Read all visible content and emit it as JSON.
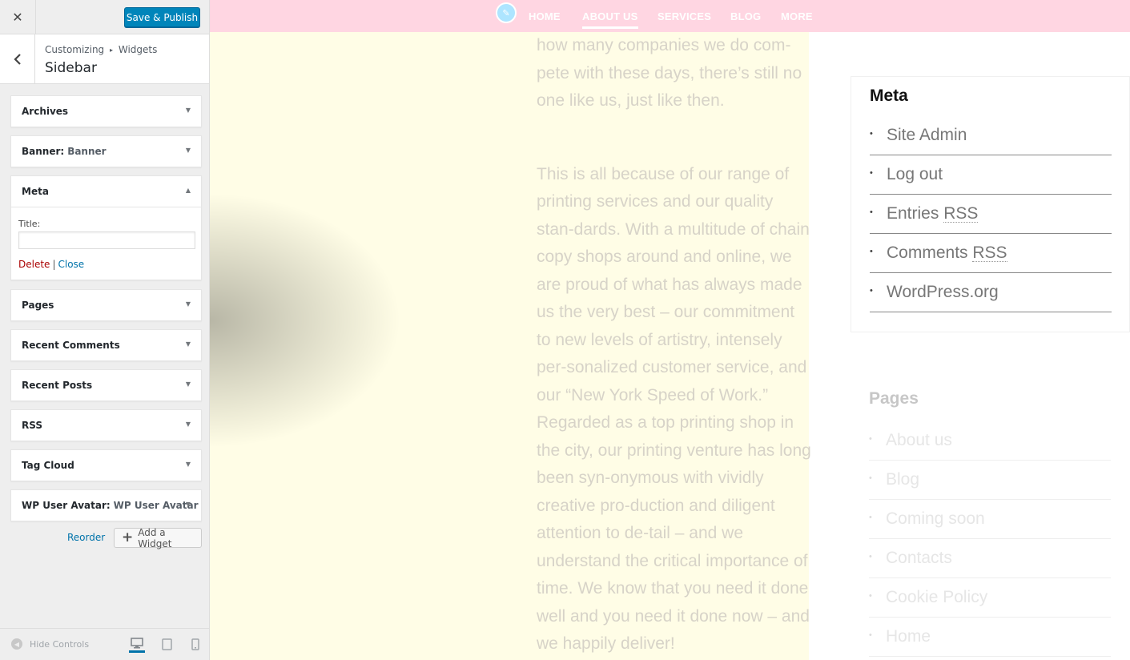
{
  "customizer": {
    "close_icon": "close-icon",
    "save_label": "Save & Publish",
    "breadcrumb": {
      "root": "Customizing",
      "separator": "▸",
      "section": "Widgets"
    },
    "section_title": "Sidebar",
    "widgets": [
      {
        "name": "Archives",
        "instance": ""
      },
      {
        "name": "Banner:",
        "instance": "Banner"
      },
      {
        "name": "Meta",
        "instance": "",
        "expanded": true
      },
      {
        "name": "Pages",
        "instance": ""
      },
      {
        "name": "Recent Comments",
        "instance": ""
      },
      {
        "name": "Recent Posts",
        "instance": ""
      },
      {
        "name": "RSS",
        "instance": ""
      },
      {
        "name": "Tag Cloud",
        "instance": ""
      },
      {
        "name": "WP User Avatar:",
        "instance": "WP User Avatar"
      }
    ],
    "meta_form": {
      "title_label": "Title:",
      "title_value": "",
      "delete_label": "Delete",
      "separator": "|",
      "close_label": "Close"
    },
    "reorder_label": "Reorder",
    "add_widget_label": "Add a Widget",
    "hide_controls_label": "Hide Controls",
    "devices": [
      "desktop",
      "tablet",
      "mobile"
    ],
    "active_device": "desktop",
    "accent_color": "#0085ba"
  },
  "preview": {
    "nav": {
      "items": [
        "HOME",
        "ABOUT US",
        "SERVICES",
        "BLOG",
        "MORE"
      ],
      "active": "ABOUT US",
      "background": "#ffd6e2"
    },
    "content": {
      "paragraph1": "how many companies we do com-pete with these days, there’s still no one like us, just like then.",
      "paragraph2": "This is all because of our range of printing services and our quality stan-dards. With a multitude of chain copy shops around and online, we are proud of what has always made us the very best – our commitment to new levels of artistry, intensely per-sonalized customer service, and our “New York Speed of Work.” Regarded as a top printing shop in the city, our printing venture has long been syn-onymous with vividly creative pro-duction and diligent attention to de-tail – and we understand the critical importance of time. We know that you need it done well and you need it done now – and we happily deliver!"
    },
    "meta_widget": {
      "title": "Meta",
      "items": [
        {
          "text": "Site Admin",
          "abbr": ""
        },
        {
          "text": "Log out",
          "abbr": ""
        },
        {
          "text": "Entries ",
          "abbr": "RSS"
        },
        {
          "text": "Comments ",
          "abbr": "RSS"
        },
        {
          "text": "WordPress.org",
          "abbr": ""
        }
      ]
    },
    "pages_widget": {
      "title": "Pages",
      "items": [
        "About us",
        "Blog",
        "Coming soon",
        "Contacts",
        "Cookie Policy",
        "Home"
      ]
    }
  }
}
